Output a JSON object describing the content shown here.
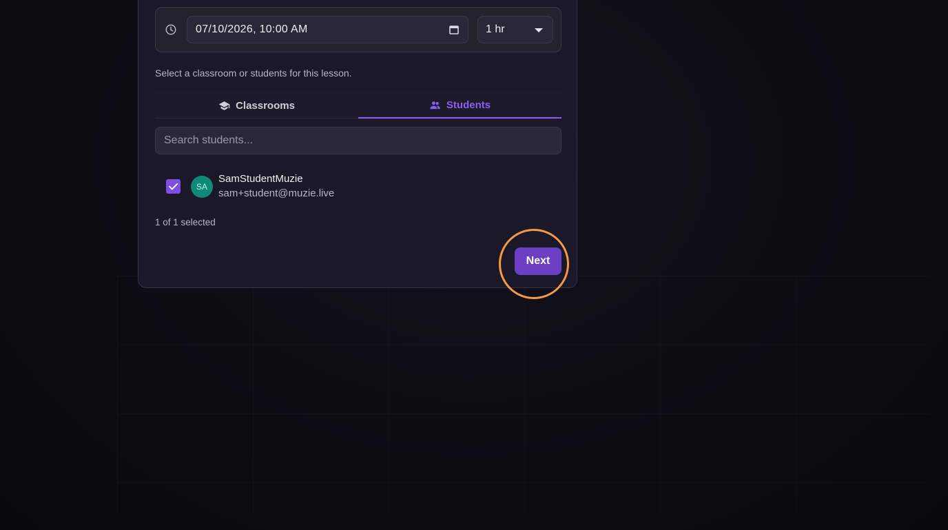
{
  "schedule": {
    "datetime_value": "07/10/2026, 10:00 AM",
    "duration_value": "1 hr"
  },
  "hint_text": "Select a classroom or students for this lesson.",
  "tabs": [
    {
      "label": "Classrooms",
      "icon": "school-icon",
      "active": false
    },
    {
      "label": "Students",
      "icon": "people-icon",
      "active": true
    }
  ],
  "search": {
    "placeholder": "Search students..."
  },
  "students": [
    {
      "initials": "SA",
      "name": "SamStudentMuzie",
      "email": "sam+student@muzie.live",
      "checked": true
    }
  ],
  "selection_summary": "1 of 1 selected",
  "footer": {
    "next_label": "Next"
  },
  "colors": {
    "accent": "#8b5cf6",
    "button": "#6a3fc4",
    "avatar": "#0f8a78",
    "highlight": "#f59a45"
  }
}
